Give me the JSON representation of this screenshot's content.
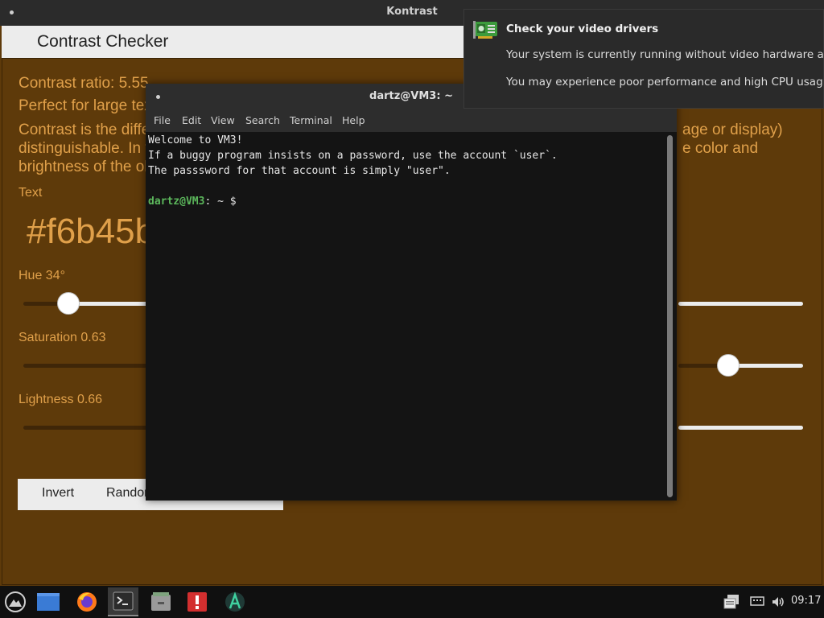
{
  "kontrast": {
    "window_title": "Kontrast",
    "header_title": "Contrast Checker",
    "ratio_text": "Contrast ratio: 5.55",
    "perfect_text": "Perfect for large tex",
    "desc_line1": "Contrast is the diffe",
    "desc_line1_right": "age or display)",
    "desc_line2": "distinguishable. In v",
    "desc_line2_right": "e color and",
    "desc_line3": "brightness of the ob",
    "text_label": "Text",
    "hex_value": "#f6b45b",
    "hue_label": "Hue 34°",
    "saturation_label": "Saturation 0.63",
    "lightness_label": "Lightness 0.66",
    "hue_value": 0.06,
    "saturation_value": 0.9,
    "invert_label": "Invert",
    "random_label": "Random",
    "background_color": "#5e3a0a",
    "text_color": "#e0a04a"
  },
  "terminal": {
    "title": "dartz@VM3: ~",
    "menu": [
      "File",
      "Edit",
      "View",
      "Search",
      "Terminal",
      "Help"
    ],
    "lines": [
      "Welcome to VM3!",
      "If a buggy program insists on a password, use the account `user`.",
      "The passsword for that account is simply \"user\"."
    ],
    "prompt_user": "dartz@VM3",
    "prompt_rest": ": ~ $"
  },
  "notification": {
    "title": "Check your video drivers",
    "line1": "Your system is currently running without video hardware acceleration.",
    "line2": "You may experience poor performance and high CPU usage.",
    "icon": "graphics-card-icon"
  },
  "taskbar": {
    "apps": [
      "menu-icon",
      "show-desktop-icon",
      "firefox-icon",
      "terminal-icon",
      "file-manager-icon",
      "alert-app-icon",
      "arch-installer-icon"
    ],
    "clock": "09:17"
  }
}
